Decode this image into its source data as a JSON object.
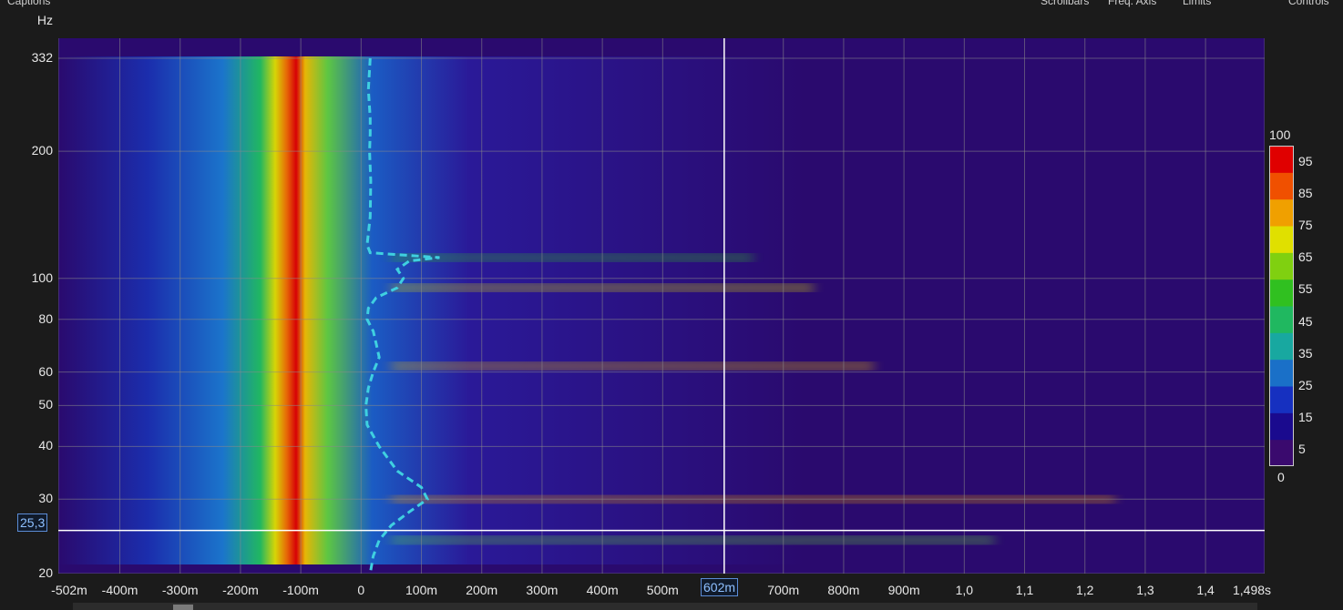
{
  "top_labels": {
    "left": "Captions",
    "scrollbars": "Scrollbars",
    "freq_axis": "Freq. Axis",
    "limits": "Limits",
    "controls": "Controls"
  },
  "chart_data": {
    "type": "heatmap",
    "title": "",
    "ylabel": "Hz",
    "xlabel": "",
    "xlim": [
      -0.502,
      1.498
    ],
    "ylim": [
      20,
      332
    ],
    "yscale": "log",
    "x_ticks": [
      "-502m",
      "-400m",
      "-300m",
      "-200m",
      "-100m",
      "0",
      "100m",
      "200m",
      "300m",
      "400m",
      "500m",
      "602m",
      "700m",
      "800m",
      "900m",
      "1,0",
      "1,1",
      "1,2",
      "1,3",
      "1,4",
      "1,498s"
    ],
    "x_tick_values": [
      -0.502,
      -0.4,
      -0.3,
      -0.2,
      -0.1,
      0,
      0.1,
      0.2,
      0.3,
      0.4,
      0.5,
      0.602,
      0.7,
      0.8,
      0.9,
      1.0,
      1.1,
      1.2,
      1.3,
      1.4,
      1.498
    ],
    "y_ticks": [
      "332",
      "200",
      "100",
      "80",
      "60",
      "50",
      "40",
      "30",
      "25,3",
      "20"
    ],
    "y_tick_values": [
      332,
      200,
      100,
      80,
      60,
      50,
      40,
      30,
      25.3,
      20
    ],
    "cursor": {
      "x": 0.602,
      "x_label": "602m",
      "y": 25.3,
      "y_label": "25,3"
    },
    "colorbar": {
      "min": 0,
      "max": 100,
      "labels": [
        "100",
        "95",
        "85",
        "75",
        "65",
        "55",
        "45",
        "35",
        "25",
        "15",
        "5",
        "0"
      ],
      "label_values": [
        100,
        95,
        85,
        75,
        65,
        55,
        45,
        35,
        25,
        15,
        5,
        0
      ],
      "colors": [
        "#3a0a6e",
        "#1a0a8e",
        "#1630c0",
        "#1a70c8",
        "#18a8a0",
        "#20b860",
        "#30c020",
        "#80d010",
        "#e0e000",
        "#f0a000",
        "#f05000",
        "#e00000"
      ]
    },
    "peak_contour": {
      "freq": [
        332,
        280,
        240,
        220,
        200,
        170,
        140,
        120,
        115,
        112,
        110,
        105,
        100,
        95,
        90,
        85,
        80,
        75,
        70,
        65,
        60,
        55,
        50,
        45,
        40,
        35,
        32,
        30,
        28,
        26,
        24,
        22,
        20
      ],
      "time": [
        0.015,
        0.012,
        0.015,
        0.015,
        0.014,
        0.016,
        0.015,
        0.01,
        0.015,
        0.13,
        0.08,
        0.06,
        0.07,
        0.06,
        0.025,
        0.012,
        0.01,
        0.02,
        0.025,
        0.03,
        0.02,
        0.012,
        0.008,
        0.01,
        0.03,
        0.06,
        0.1,
        0.11,
        0.08,
        0.05,
        0.03,
        0.02,
        0.015
      ]
    }
  }
}
